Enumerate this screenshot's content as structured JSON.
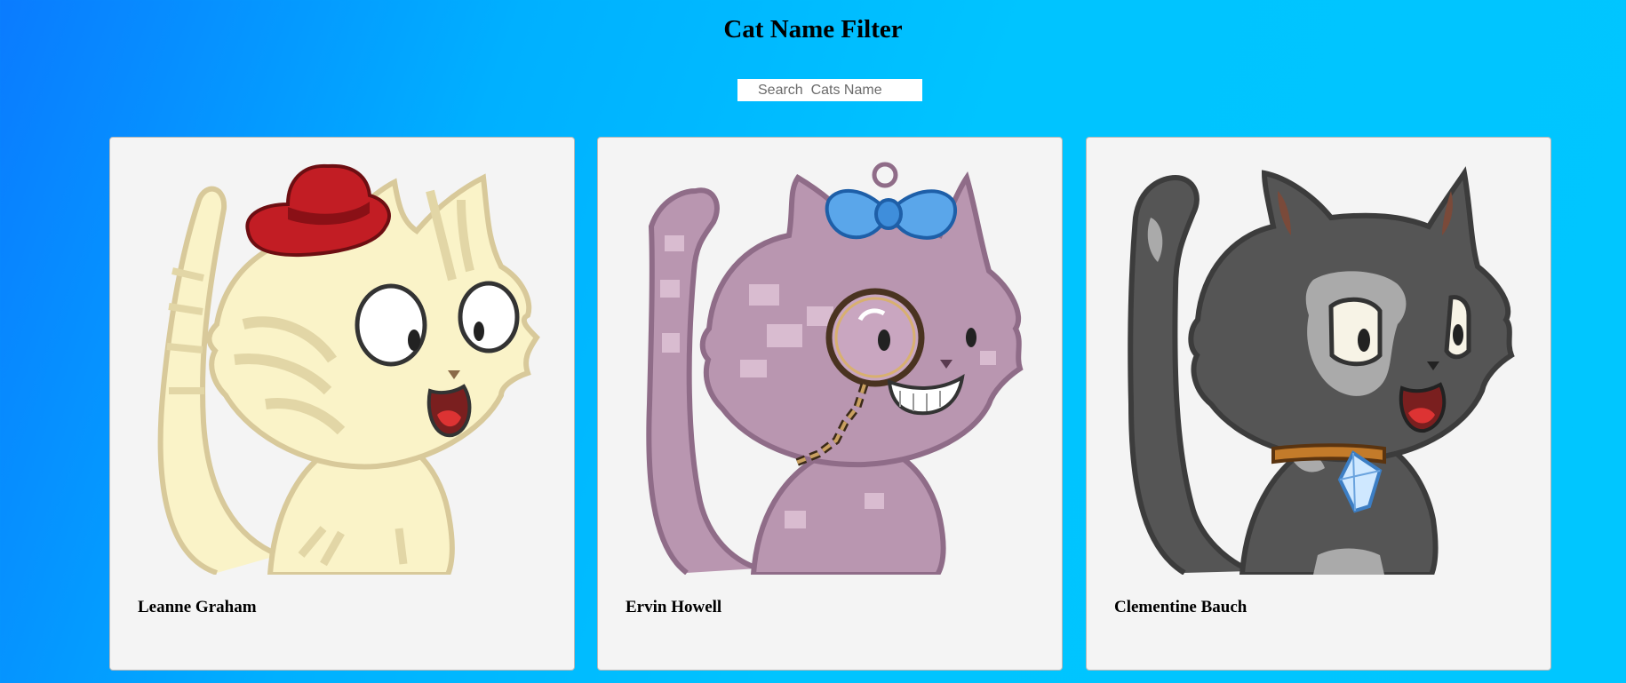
{
  "page": {
    "title": "Cat Name Filter"
  },
  "search": {
    "placeholder": "Search  Cats Name"
  },
  "cats": [
    {
      "name": "Leanne Graham",
      "image_icon": "cream-cat-red-hat-icon"
    },
    {
      "name": "Ervin Howell",
      "image_icon": "purple-cat-monocle-bow-icon"
    },
    {
      "name": "Clementine Bauch",
      "image_icon": "grey-cat-diamond-collar-icon"
    }
  ],
  "colors": {
    "background_start": "#0a7bff",
    "background_end": "#00c6ff",
    "card_background": "#f4f4f4"
  }
}
